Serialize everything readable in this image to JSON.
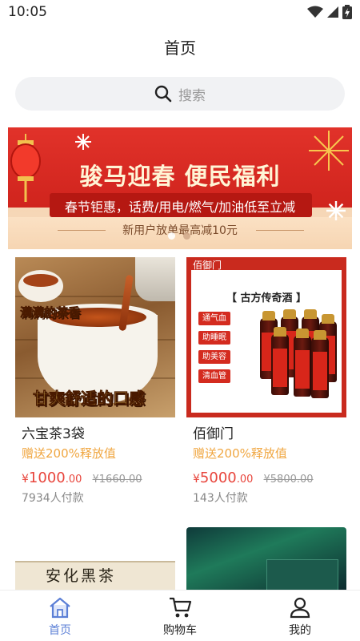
{
  "status_bar": {
    "time": "10:05"
  },
  "header": {
    "title": "首页"
  },
  "search": {
    "placeholder": "搜索"
  },
  "banner": {
    "headline": "骏马迎春 便民福利",
    "subline": "春节钜惠，话费/用电/燃气/加油低至立减",
    "note": "新用户放单最高减10元"
  },
  "products": [
    {
      "name": "六宝茶3袋",
      "bonus": "赠送200%释放值",
      "price_symbol": "¥",
      "price_int": "1000",
      "price_dec": ".00",
      "original_price": "¥1660.00",
      "sold": "7934人付款",
      "image_texts": {
        "top": "满满的茶香",
        "bottom": "甘爽舒适的口感"
      }
    },
    {
      "name": "佰御门",
      "bonus": "赠送200%释放值",
      "price_symbol": "¥",
      "price_int": "5000",
      "price_dec": ".00",
      "original_price": "¥5800.00",
      "sold": "143人付款",
      "image_texts": {
        "brand": "佰御门",
        "title": "【 古方传奇酒 】",
        "tags": [
          "通气血",
          "助睡眠",
          "助美容",
          "清血管"
        ]
      }
    },
    {
      "image_texts": {
        "title": "安化黑茶"
      }
    },
    {
      "image_texts": {}
    }
  ],
  "tabbar": {
    "items": [
      {
        "label": "首页",
        "icon": "home-icon",
        "active": true
      },
      {
        "label": "购物车",
        "icon": "cart-icon",
        "active": false
      },
      {
        "label": "我的",
        "icon": "user-icon",
        "active": false
      }
    ]
  },
  "colors": {
    "accent": "#5b7fd6",
    "price": "#e8453c",
    "bonus": "#f0a640",
    "banner_red": "#d42a22"
  }
}
